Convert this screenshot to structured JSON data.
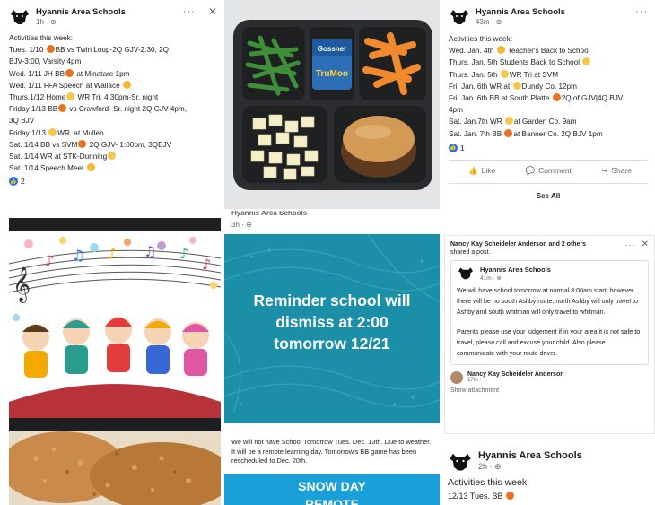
{
  "page_name": "Hyannis Area Schools",
  "post1": {
    "time": "1h · ",
    "heading": "Activities this week:",
    "lines": [
      {
        "pre": "Tues. 1/10 ",
        "emoji": "ball",
        "post": "BB vs Twin Loup-2Q GJV-2:30, 2Q"
      },
      {
        "pre": "BJV-3:00, Varsity 4pm",
        "emoji": "",
        "post": ""
      },
      {
        "pre": "Wed. 1/11 JH BB",
        "emoji": "ball",
        "post": " at Minatare 1pm"
      },
      {
        "pre": "Wed. 1/11 FFA Speech at Wallace ",
        "emoji": "face",
        "post": ""
      },
      {
        "pre": "Thurs.1/12 Home",
        "emoji": "food",
        "post": " WR Tri. 4:30pm-Sr. night"
      },
      {
        "pre": "Friday 1/13 BB",
        "emoji": "ball",
        "post": " vs Crawford- Sr. night 2Q GJV 4pm,"
      },
      {
        "pre": "3Q BJV",
        "emoji": "",
        "post": ""
      },
      {
        "pre": "Friday 1/13 ",
        "emoji": "food",
        "post": "WR. at Mullen"
      },
      {
        "pre": "Sat. 1/14 BB vs SVM",
        "emoji": "ball",
        "post": " 2Q GJV- 1:00pm, 3QBJV"
      },
      {
        "pre": "Sat. 1/14 WR at STK-Dunning",
        "emoji": "food",
        "post": ""
      },
      {
        "pre": "Sat. 1/14 Speech Meet ",
        "emoji": "face",
        "post": ""
      }
    ],
    "reactions": "2"
  },
  "post2": {
    "time": "43m · ",
    "heading": "Activities this week:",
    "lines": [
      {
        "pre": "Wed. Jan. 4th ",
        "emoji": "face",
        "post": " Teacher's Back to School"
      },
      {
        "pre": "Thurs. Jan. 5th Students Back to School ",
        "emoji": "food",
        "post": ""
      },
      {
        "pre": "Thurs. Jan. 5th ",
        "emoji": "food",
        "post": "WR Tri at SVM"
      },
      {
        "pre": "Fri. Jan. 6th WR at ",
        "emoji": "food",
        "post": "Dundy Co. 12pm"
      },
      {
        "pre": "Fri. Jan. 6th BB at South Platte ",
        "emoji": "ball",
        "post": "2Q of GJV|4Q BJV"
      },
      {
        "pre": "4pm",
        "emoji": "",
        "post": ""
      },
      {
        "pre": "Sat. Jan.7th WR ",
        "emoji": "food",
        "post": "at Garden Co. 9am"
      },
      {
        "pre": "Sat. Jan. 7th BB ",
        "emoji": "ball",
        "post": "at Banner Co. 2Q BJV 1pm"
      }
    ],
    "reactions": "1",
    "like": "Like",
    "comment": "Comment",
    "share": "Share",
    "see_all": "See All"
  },
  "reminder": {
    "page_name_partial": "Hyannis Area Schools",
    "time": "3h · ",
    "line1": "Reminder school will",
    "line2": "dismiss at 2:00",
    "line3": "tomorrow 12/21"
  },
  "shared": {
    "header": "Nancy Kay Scheideler Anderson and 2 others",
    "header2": "shared a post.",
    "page_name": "Hyannis Area Schools",
    "time": "41m · ",
    "body1": "We will have school tomorrow at normal 8:00am start; however there will be no south Ashby route, north Ashby will only travel to Ashby and south whitman will only travel to whitman.",
    "body2": "Parents please use your judgement if in your area it is not safe to travel, please call and excuse your child. Also please communicate with your route driver.",
    "commenter": "Nancy Kay Scheideler Anderson",
    "commenter_time": "17m · ",
    "attachment": "Show attachment"
  },
  "snow": {
    "text": "We will not have School Tomorrow Tues. Dec. 13th.  Due to weather.  It will be a remote learning day.  Tomorrow's BB game has been rescheduled to Dec. 20th.",
    "banner1": "SNOW DAY",
    "banner2": "REMOTE"
  },
  "post3": {
    "page_name": "Hyannis Area Schools",
    "time": "2h · ",
    "heading": "Activities this week:",
    "partial": "12/13 Tues. BB"
  },
  "milk_brand": "TruMoo",
  "milk_top": "Gossner",
  "colors": {
    "facebook_blue": "#1877f2",
    "teal_background": "#1b8fa8",
    "snow_banner": "#1aa0d8"
  }
}
